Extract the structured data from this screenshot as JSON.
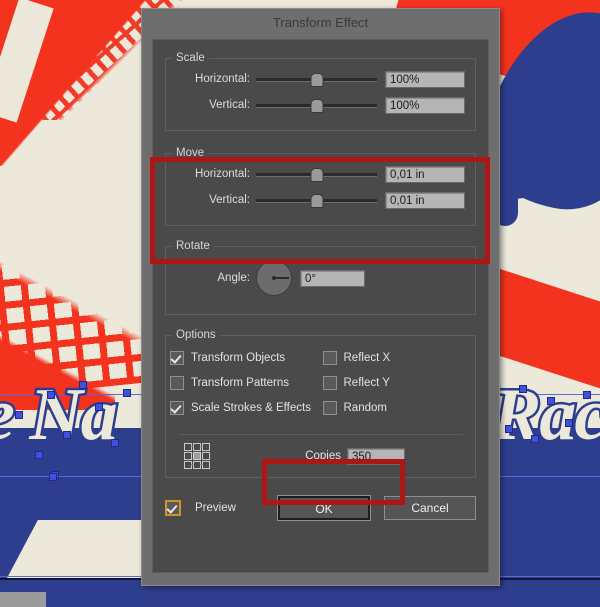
{
  "app": {
    "background_colors": {
      "canvas": "#ece8da",
      "red_art": "#f4331f",
      "navy_art": "#2e3e8f",
      "selection_blue": "#3f4fe0"
    },
    "artwork_text": {
      "left_script": "e Na",
      "right_script": "Rac"
    }
  },
  "dialog": {
    "title": "Transform Effect",
    "colors": {
      "frame": "#6e6e6e",
      "panel": "#4a4a4a",
      "field": "#b5b5b5",
      "annotation": "#b01515",
      "focus": "#d6912c"
    },
    "scale": {
      "legend": "Scale",
      "rows": [
        {
          "label": "Horizontal:",
          "value": "100%",
          "thumb_pct": 50
        },
        {
          "label": "Vertical:",
          "value": "100%",
          "thumb_pct": 50
        }
      ]
    },
    "move": {
      "legend": "Move",
      "highlighted": true,
      "rows": [
        {
          "label": "Horizontal:",
          "value": "0,01 in",
          "thumb_pct": 50
        },
        {
          "label": "Vertical:",
          "value": "0,01 in",
          "thumb_pct": 50
        }
      ]
    },
    "rotate": {
      "legend": "Rotate",
      "label": "Angle:",
      "value": "0°",
      "dial_degrees": 180
    },
    "options": {
      "legend": "Options",
      "left_column": [
        {
          "label": "Transform Objects",
          "checked": true
        },
        {
          "label": "Transform Patterns",
          "checked": false
        },
        {
          "label": "Scale Strokes & Effects",
          "checked": true
        }
      ],
      "right_column": [
        {
          "label": "Reflect X",
          "checked": false
        },
        {
          "label": "Reflect Y",
          "checked": false
        },
        {
          "label": "Random",
          "checked": false
        }
      ]
    },
    "copies": {
      "label": "Copies",
      "value": "350",
      "highlighted": true,
      "anchor_icon": "nine-point-reference-grid"
    },
    "footer": {
      "preview_label": "Preview",
      "preview_checked": true,
      "preview_focused": true,
      "ok_label": "OK",
      "cancel_label": "Cancel"
    }
  }
}
